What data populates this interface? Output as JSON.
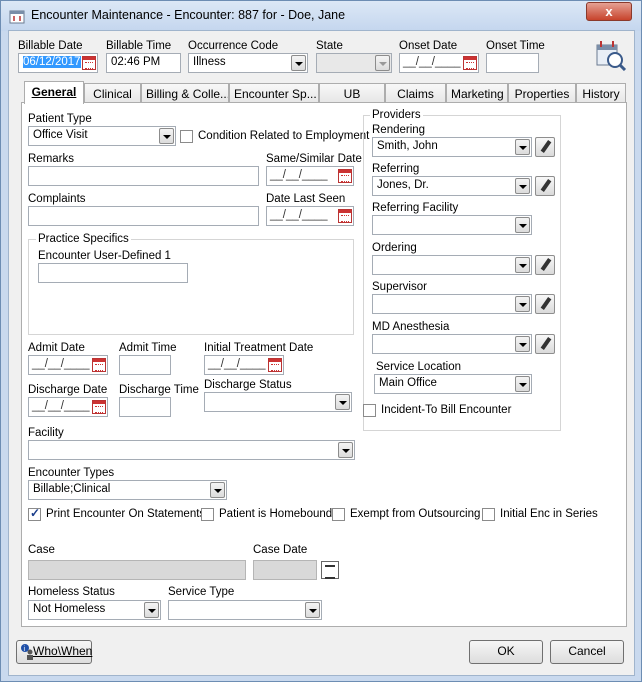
{
  "window": {
    "title": "Encounter Maintenance - Encounter: 887 for - Doe, Jane",
    "close_label": "x"
  },
  "header": {
    "billable_date_label": "Billable Date",
    "billable_date_value": "06/12/2017",
    "billable_time_label": "Billable Time",
    "billable_time_value": "02:46 PM",
    "occurrence_code_label": "Occurrence Code",
    "occurrence_code_value": "Illness",
    "state_label": "State",
    "state_value": "",
    "onset_date_label": "Onset Date",
    "onset_date_value": "__/__/____",
    "onset_time_label": "Onset Time",
    "onset_time_value": ""
  },
  "tabs": [
    {
      "label": "General"
    },
    {
      "label": "Clinical"
    },
    {
      "label": "Billing & Colle..."
    },
    {
      "label": "Encounter  Sp..."
    },
    {
      "label": "UB"
    },
    {
      "label": "Claims"
    },
    {
      "label": "Marketing"
    },
    {
      "label": "Properties"
    },
    {
      "label": "History"
    }
  ],
  "general": {
    "patient_type_label": "Patient Type",
    "patient_type_value": "Office Visit",
    "condition_employment_label": "Condition Related to Employment",
    "remarks_label": "Remarks",
    "remarks_value": "",
    "same_similar_date_label": "Same/Similar Date",
    "same_similar_date_value": "__/__/____",
    "complaints_label": "Complaints",
    "complaints_value": "",
    "date_last_seen_label": "Date Last Seen",
    "date_last_seen_value": "__/__/____",
    "practice_specifics_label": "Practice Specifics",
    "encounter_user_defined_label": "Encounter User-Defined 1",
    "encounter_user_defined_value": "",
    "admit_date_label": "Admit Date",
    "admit_date_value": "__/__/____",
    "admit_time_label": "Admit Time",
    "admit_time_value": "",
    "initial_treatment_date_label": "Initial Treatment Date",
    "initial_treatment_date_value": "__/__/____",
    "discharge_date_label": "Discharge Date",
    "discharge_date_value": "__/__/____",
    "discharge_time_label": "Discharge Time",
    "discharge_time_value": "",
    "discharge_status_label": "Discharge Status",
    "discharge_status_value": "",
    "facility_label": "Facility",
    "facility_value": "",
    "encounter_types_label": "Encounter Types",
    "encounter_types_value": "Billable;Clinical",
    "print_on_statements_label": "Print Encounter On Statements",
    "homebound_label": "Patient is Homebound",
    "exempt_outsourcing_label": "Exempt from Outsourcing",
    "initial_enc_series_label": "Initial Enc in Series",
    "case_label": "Case",
    "case_value": "",
    "case_date_label": "Case Date",
    "case_date_value": "",
    "homeless_status_label": "Homeless Status",
    "homeless_status_value": "Not Homeless",
    "service_type_label": "Service Type",
    "service_type_value": ""
  },
  "providers": {
    "group_label": "Providers",
    "rendering_label": "Rendering",
    "rendering_value": "Smith, John",
    "referring_label": "Referring",
    "referring_value": "Jones, Dr.",
    "referring_facility_label": "Referring Facility",
    "referring_facility_value": "",
    "ordering_label": "Ordering",
    "ordering_value": "",
    "supervisor_label": "Supervisor",
    "supervisor_value": "",
    "md_anesthesia_label": "MD Anesthesia",
    "md_anesthesia_value": "",
    "service_location_label": "Service Location",
    "service_location_value": "Main Office",
    "incident_to_label": "Incident-To Bill Encounter"
  },
  "footer": {
    "who_when_label": "Who\\When",
    "ok_label": "OK",
    "cancel_label": "Cancel"
  }
}
